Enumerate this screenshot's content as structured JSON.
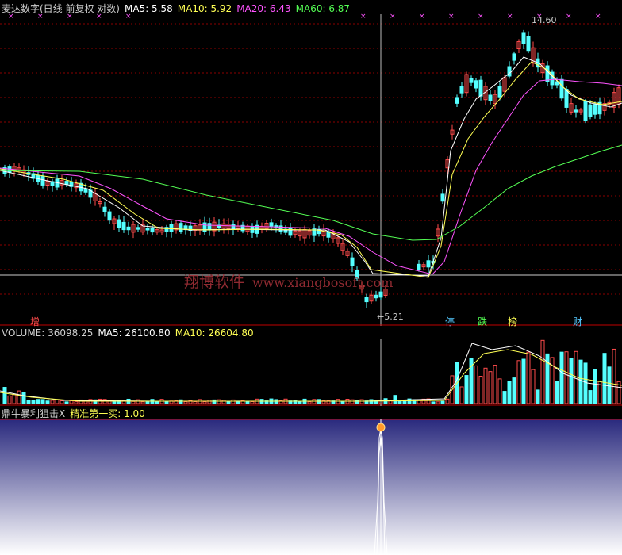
{
  "price_header": {
    "title": "麦达数字(日线 前复权 对数)",
    "ma5": "MA5: 5.58",
    "ma10": "MA10: 5.92",
    "ma20": "MA20: 6.43",
    "ma60": "MA60: 6.87"
  },
  "volume_header": {
    "volume": "VOLUME: 36098.25",
    "ma5": "MA5: 26100.80",
    "ma10": "MA10: 26604.80"
  },
  "indicator_header": {
    "name": "鼎牛暴利狙击X",
    "signal": "精准第一买: 1.00"
  },
  "annotations": {
    "high": "14.60",
    "low": "5.21",
    "event_zeng": "增",
    "event_ting": "停",
    "event_die": "跌",
    "event_bang": "榜",
    "event_cai": "财"
  },
  "watermark": {
    "cn": "翔博软件",
    "url": "www.xiangbosoft.com"
  },
  "colors": {
    "up": "#ff4b4b",
    "down": "#54ffff",
    "ma5": "#ffffff",
    "ma10": "#ffff54",
    "ma20": "#ff54ff",
    "ma60": "#54ff54",
    "grid": "#8b0000",
    "indicator_bg_top": "#2a2a7e",
    "indicator_bg_bottom": "#ffffff"
  }
}
